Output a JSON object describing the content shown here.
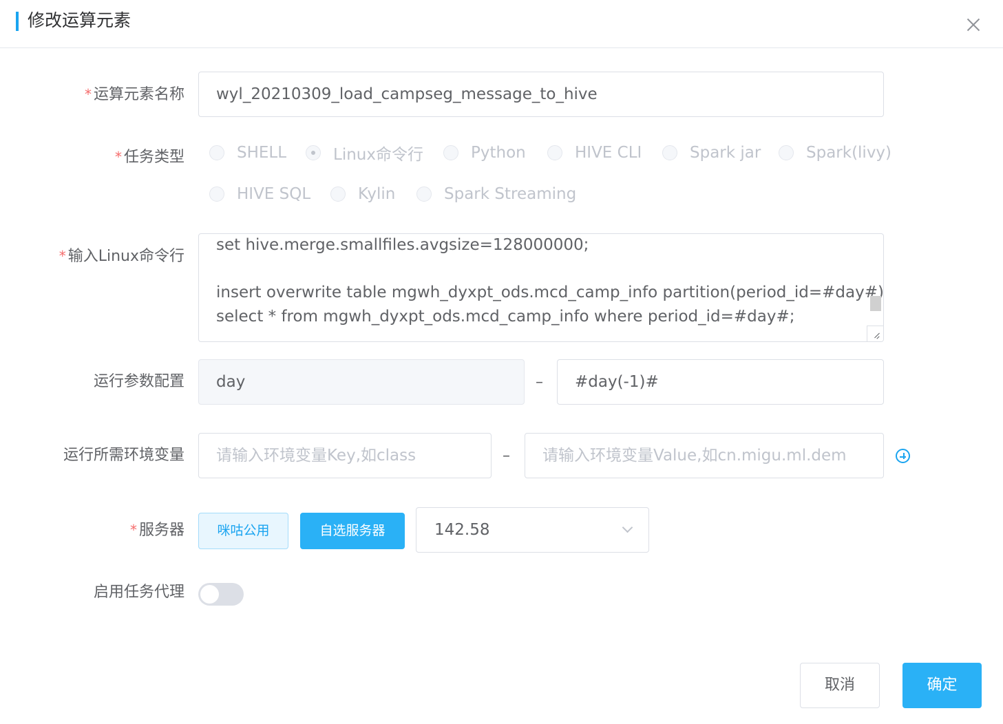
{
  "dialog": {
    "title": "修改运算元素"
  },
  "form": {
    "name": {
      "label": "运算元素名称",
      "value": "wyl_20210309_load_campseg_message_to_hive"
    },
    "task_type": {
      "label": "任务类型",
      "options": [
        "SHELL",
        "Linux命令行",
        "Python",
        "HIVE CLI",
        "Spark jar",
        "Spark(livy)",
        "HIVE SQL",
        "Kylin",
        "Spark Streaming"
      ],
      "selected": "Linux命令行"
    },
    "command": {
      "label": "输入Linux命令行",
      "lines": [
        "set hive.merge.smallfiles.avgsize=128000000;",
        "",
        "insert overwrite table mgwh_dyxpt_ods.mcd_camp_info partition(period_id=#day#)",
        "select * from mgwh_dyxpt_ods.mcd_camp_info where period_id=#day#;"
      ]
    },
    "run_params": {
      "label": "运行参数配置",
      "key": "day",
      "separator": "–",
      "value": "#day(-1)#"
    },
    "env_vars": {
      "label": "运行所需环境变量",
      "key_placeholder": "请输入环境变量Key,如class",
      "separator": "–",
      "value_placeholder": "请输入环境变量Value,如cn.migu.ml.dem"
    },
    "server": {
      "label": "服务器",
      "public_button": "咪咕公用",
      "custom_button": "自选服务器",
      "selected": "142.58"
    },
    "proxy": {
      "label": "启用任务代理",
      "enabled": false
    }
  },
  "footer": {
    "cancel": "取消",
    "confirm": "确定"
  },
  "colors": {
    "accent": "#2ab1f6",
    "required": "#f56c6c"
  }
}
